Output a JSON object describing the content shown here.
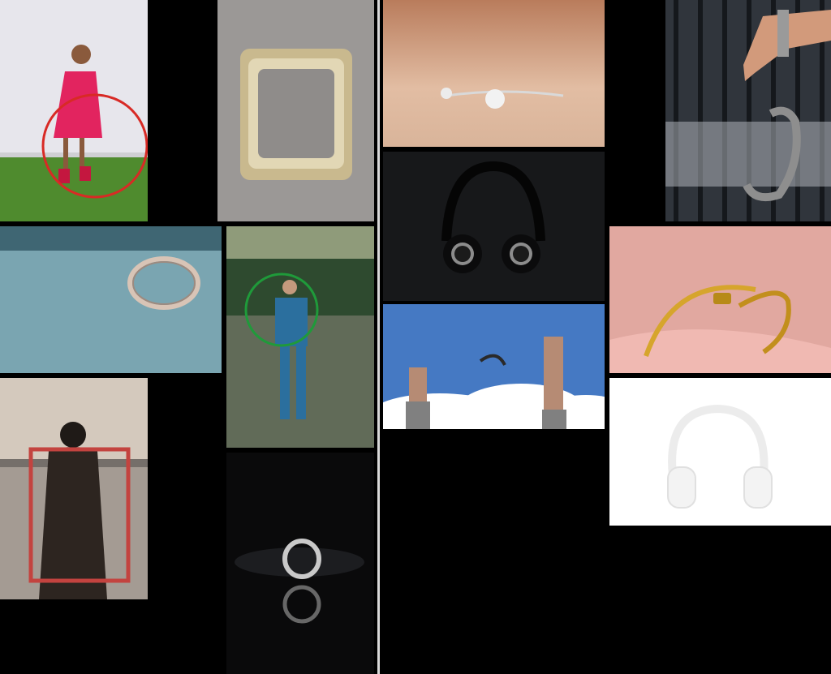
{
  "gallery": {
    "background": "#000000",
    "divider_color": "#d8d8d8",
    "photos": [
      {
        "subject": "girl-with-hula-hoop"
      },
      {
        "subject": "ornate-picture-frame"
      },
      {
        "subject": "diamond-cuff-bracelet"
      },
      {
        "subject": "hand-with-handcuff"
      },
      {
        "subject": "diamond-ring"
      },
      {
        "subject": "man-with-green-hoop"
      },
      {
        "subject": "black-headphones"
      },
      {
        "subject": "gold-nail-bracelet"
      },
      {
        "subject": "hands-breaking-handcuffs"
      },
      {
        "subject": "person-holding-red-frame"
      },
      {
        "subject": "white-headphones"
      },
      {
        "subject": "silver-ring-reflection"
      }
    ]
  }
}
